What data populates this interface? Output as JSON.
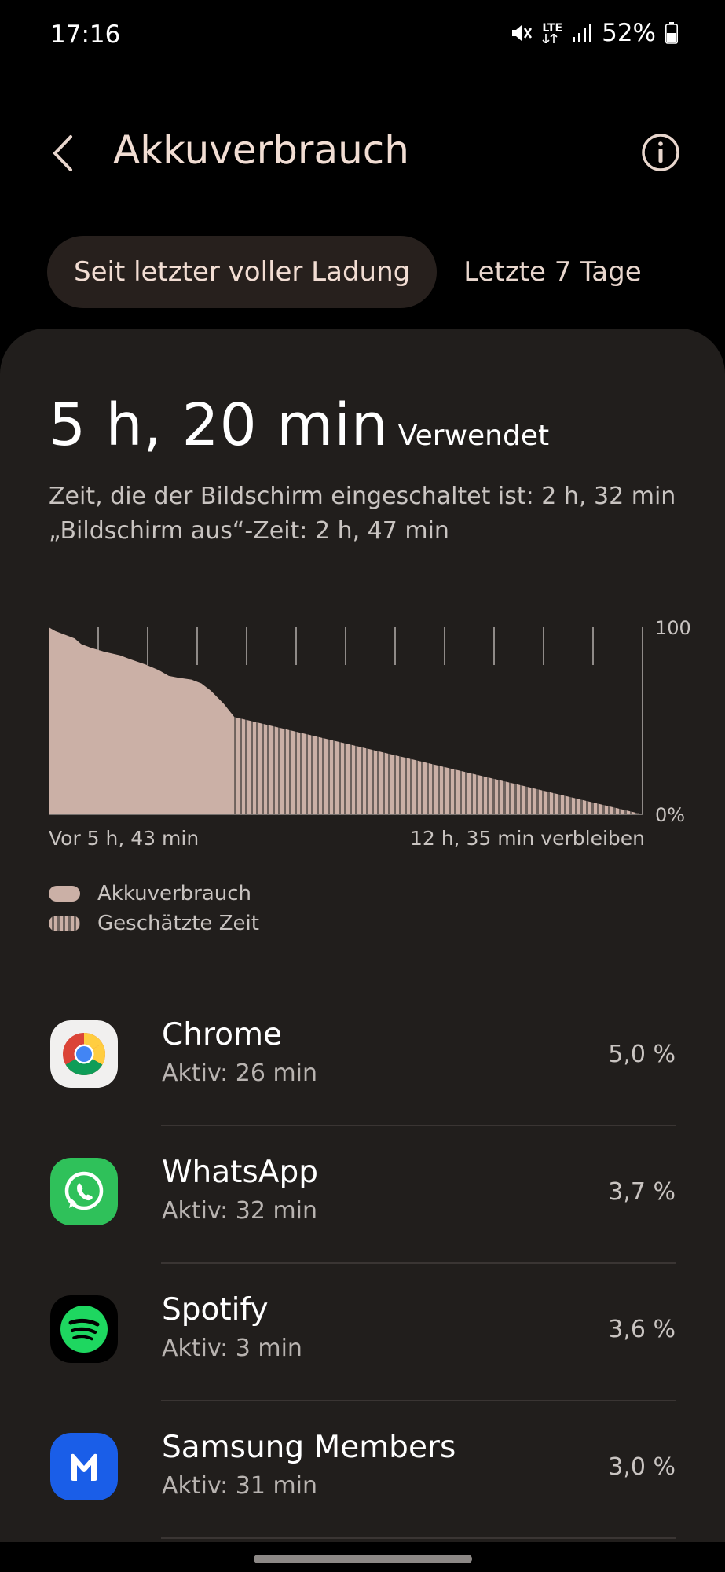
{
  "status_bar": {
    "time": "17:16",
    "network": "LTE",
    "battery": "52%",
    "icons": [
      "mute-vibrate-icon",
      "lte-icon",
      "signal-icon",
      "battery-icon"
    ]
  },
  "header": {
    "title": "Akkuverbrauch",
    "back_icon": "chevron-left-icon",
    "info_icon": "info-icon"
  },
  "tabs": [
    {
      "label": "Seit letzter voller Ladung",
      "selected": true
    },
    {
      "label": "Letzte 7 Tage",
      "selected": false
    }
  ],
  "summary": {
    "used_value": "5 h, 20 min",
    "used_label": "Verwendet",
    "screen_on": "Zeit, die der Bildschirm eingeschaltet ist: 2 h, 32 min",
    "screen_off": "„Bildschirm aus“-Zeit: 2 h, 47 min"
  },
  "chart_data": {
    "type": "area",
    "y_axis_labels": [
      "100",
      "0%"
    ],
    "ylim": [
      0,
      100
    ],
    "x_start_label": "Vor 5 h, 43 min",
    "x_end_label": "12 h, 35 min verbleiben",
    "grid": true,
    "legend_position": "bottom-left",
    "series": [
      {
        "name": "Akkuverbrauch",
        "x": [
          0,
          0.2,
          0.5,
          0.8,
          1.0,
          1.3,
          1.7,
          2.2,
          2.5,
          3.0,
          3.4,
          3.6,
          3.7,
          4.0,
          4.4,
          4.7,
          5.0,
          5.4,
          5.72
        ],
        "y": [
          100,
          98,
          96,
          94,
          91,
          89,
          87,
          85,
          83,
          80,
          77,
          75,
          74,
          73,
          72,
          70,
          66,
          59,
          52
        ]
      },
      {
        "name": "Geschätzte Zeit",
        "x": [
          5.72,
          18.3
        ],
        "y": [
          52,
          0
        ]
      }
    ],
    "x_total": 18.3,
    "colors": {
      "usage": "#cbb0a6",
      "estimate_stripe": "#6e625d",
      "grid": "#8f8a87"
    }
  },
  "legend": {
    "usage": "Akkuverbrauch",
    "estimate": "Geschätzte Zeit"
  },
  "apps": [
    {
      "name": "Chrome",
      "active": "Aktiv: 26 min",
      "percent": "5,0 %",
      "icon": "chrome-icon"
    },
    {
      "name": "WhatsApp",
      "active": "Aktiv: 32 min",
      "percent": "3,7 %",
      "icon": "whatsapp-icon"
    },
    {
      "name": "Spotify",
      "active": "Aktiv: 3 min",
      "percent": "3,6 %",
      "icon": "spotify-icon"
    },
    {
      "name": "Samsung Members",
      "active": "Aktiv: 31 min",
      "percent": "3,0 %",
      "icon": "samsung-members-icon"
    }
  ]
}
